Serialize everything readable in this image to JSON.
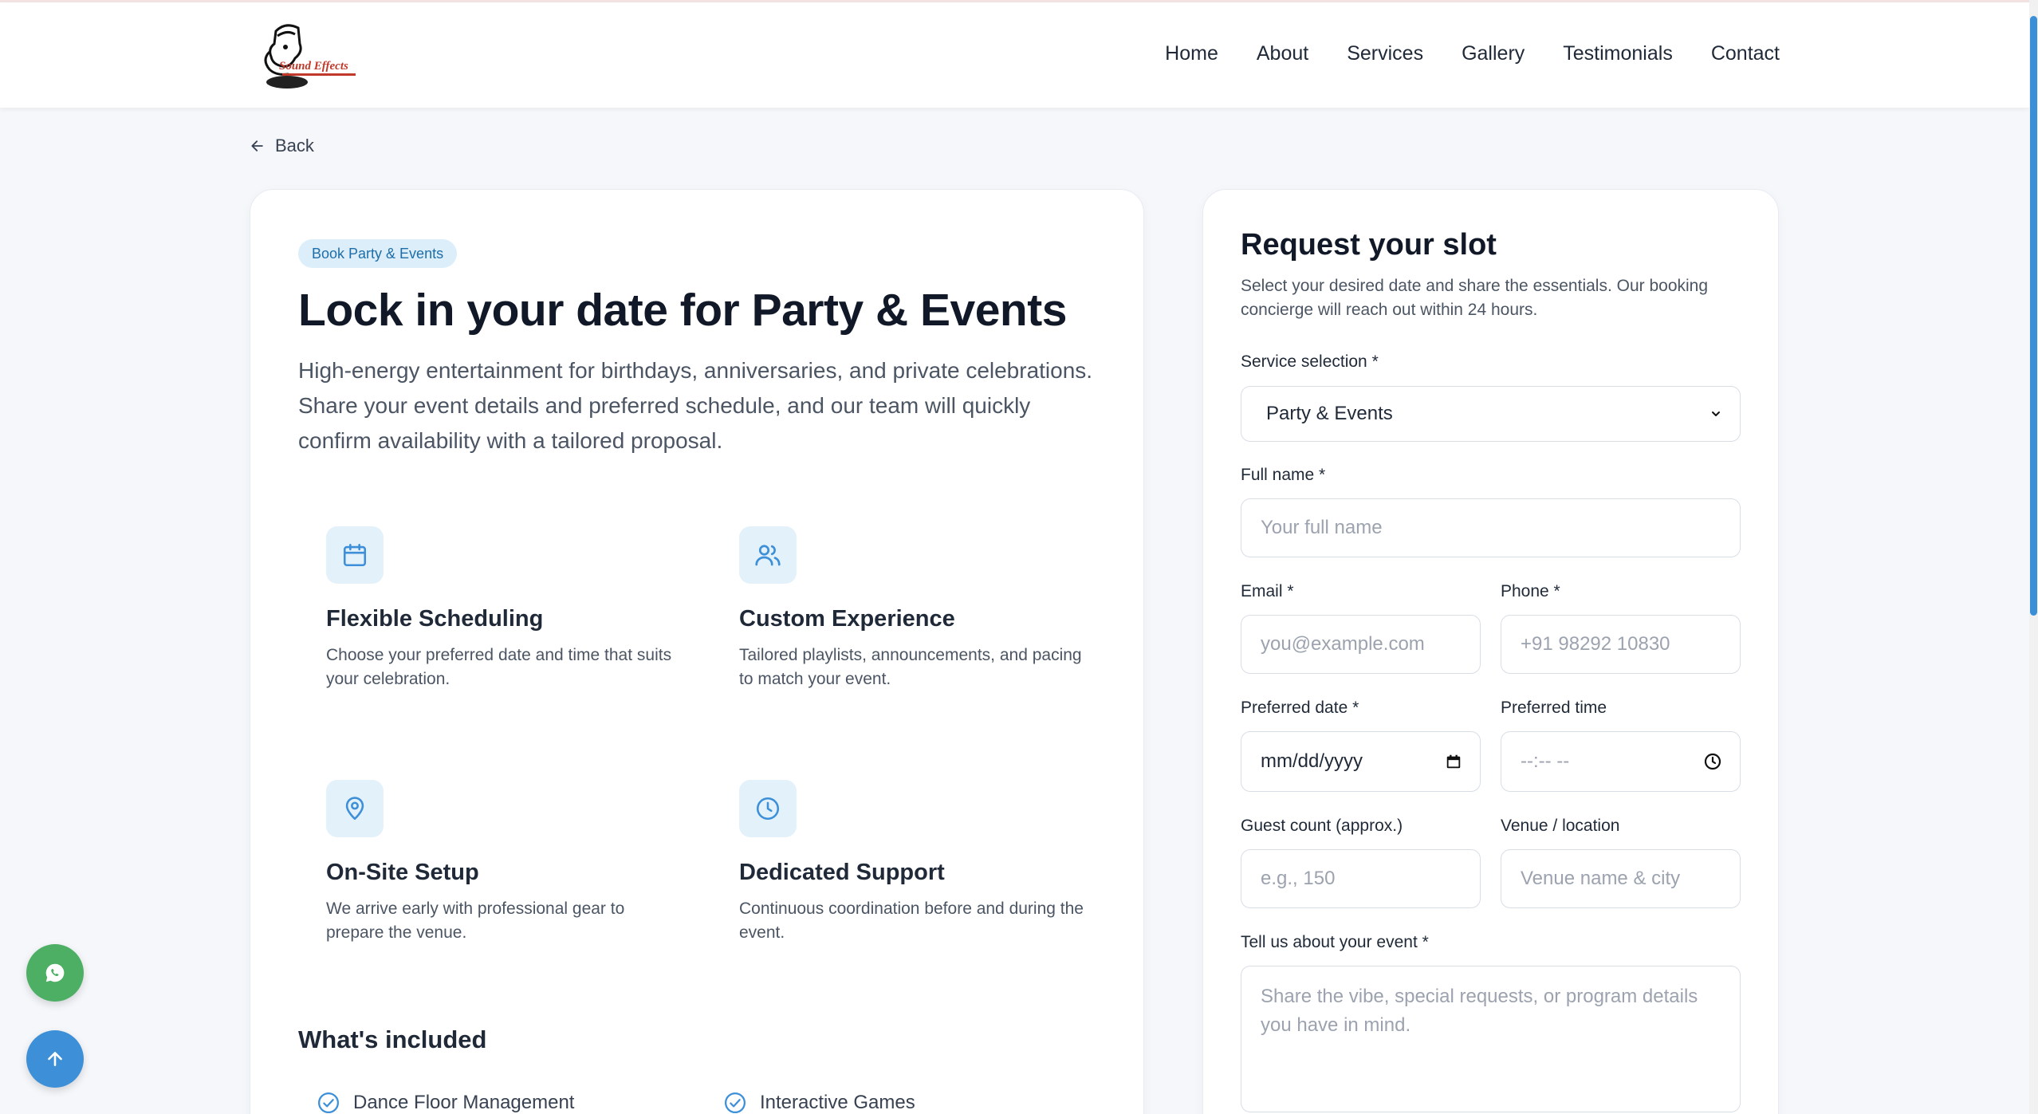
{
  "brand": {
    "logo_text": "Sound Effects"
  },
  "nav": [
    {
      "label": "Home"
    },
    {
      "label": "About"
    },
    {
      "label": "Services"
    },
    {
      "label": "Gallery"
    },
    {
      "label": "Testimonials"
    },
    {
      "label": "Contact"
    }
  ],
  "back_label": "Back",
  "hero": {
    "badge": "Book Party & Events",
    "title": "Lock in your date for Party & Events",
    "intro": "High-energy entertainment for birthdays, anniversaries, and private celebrations. Share your event details and preferred schedule, and our team will quickly confirm availability with a tailored proposal."
  },
  "features": [
    {
      "icon": "calendar-icon",
      "title": "Flexible Scheduling",
      "desc": "Choose your preferred date and time that suits your celebration."
    },
    {
      "icon": "users-icon",
      "title": "Custom Experience",
      "desc": "Tailored playlists, announcements, and pacing to match your event."
    },
    {
      "icon": "map-pin-icon",
      "title": "On-Site Setup",
      "desc": "We arrive early with professional gear to prepare the venue."
    },
    {
      "icon": "clock-icon",
      "title": "Dedicated Support",
      "desc": "Continuous coordination before and during the event."
    }
  ],
  "included": {
    "title": "What's included",
    "items": [
      "Dance Floor Management",
      "Interactive Games"
    ]
  },
  "form": {
    "title": "Request your slot",
    "desc": "Select your desired date and share the essentials. Our booking concierge will reach out within 24 hours.",
    "service_label": "Service selection *",
    "service_value": "Party & Events",
    "name_label": "Full name *",
    "name_placeholder": "Your full name",
    "email_label": "Email *",
    "email_placeholder": "you@example.com",
    "phone_label": "Phone *",
    "phone_placeholder": "+91 98292 10830",
    "date_label": "Preferred date *",
    "date_placeholder": "mm/dd/yyyy",
    "time_label": "Preferred time",
    "time_placeholder": "--:-- --",
    "guests_label": "Guest count (approx.)",
    "guests_placeholder": "e.g., 150",
    "venue_label": "Venue / location",
    "venue_placeholder": "Venue name & city",
    "event_label": "Tell us about your event *",
    "event_placeholder": "Share the vibe, special requests, or program details you have in mind."
  },
  "colors": {
    "accent": "#3d8fd8",
    "whatsapp": "#4caf63",
    "icon_bg": "#e3f1fb"
  }
}
